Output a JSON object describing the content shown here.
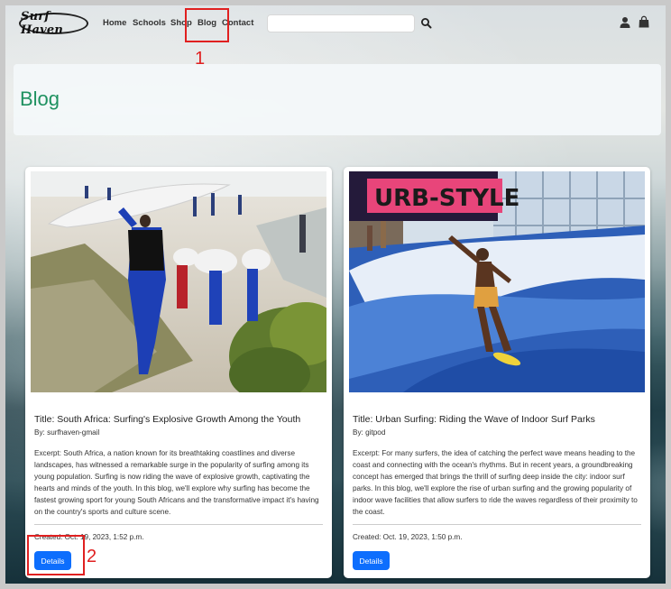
{
  "navbar": {
    "logo_text": "Surf Haven",
    "links": [
      "Home",
      "Schools",
      "Shop",
      "Blog",
      "Contact"
    ],
    "search": {
      "placeholder": "",
      "value": ""
    },
    "icons": [
      "search-icon",
      "user-icon",
      "shopping-bag-icon"
    ]
  },
  "hero": {
    "title": "Blog"
  },
  "posts": [
    {
      "title": "Title: South Africa: Surfing's Explosive Growth Among the Youth",
      "author": "By: surfhaven-gmail",
      "excerpt": "Excerpt: South Africa, a nation known for its breathtaking coastlines and diverse landscapes, has witnessed a remarkable surge in the popularity of surfing among its young population. Surfing is now riding the wave of explosive growth, captivating the hearts and minds of the youth. In this blog, we'll explore why surfing has become the fastest growing sport for young South Africans and the transformative impact it's having on the country's sports and culture scene.",
      "created": "Created: Oct. 19, 2023, 1:52 p.m.",
      "button_label": "Details"
    },
    {
      "title": "Title: Urban Surfing: Riding the Wave of Indoor Surf Parks",
      "author": "By: gitpod",
      "excerpt": "Excerpt: For many surfers, the idea of catching the perfect wave means heading to the coast and connecting with the ocean's rhythms. But in recent years, a groundbreaking concept has emerged that brings the thrill of surfing deep inside the city: indoor surf parks. In this blog, we'll explore the rise of urban surfing and the growing popularity of indoor wave facilities that allow surfers to ride the waves regardless of their proximity to the coast.",
      "created": "Created: Oct. 19, 2023, 1:50 p.m.",
      "button_label": "Details"
    }
  ],
  "images": {
    "card1_sign": "",
    "card2_sign": "URB-STYLE"
  },
  "annotations": [
    "1",
    "2"
  ],
  "colors": {
    "accent_green": "#1e9160",
    "button_blue": "#0d6efd",
    "annotation_red": "#e02020"
  }
}
